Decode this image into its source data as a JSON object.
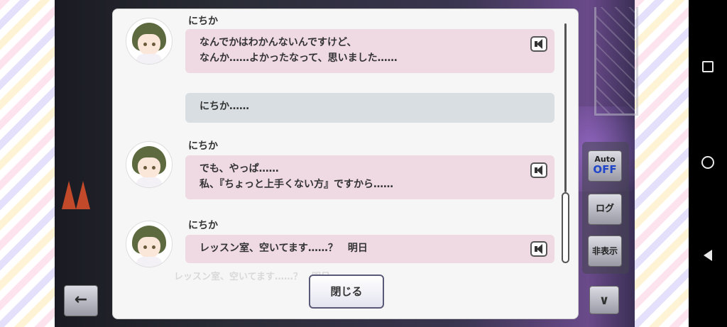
{
  "log": {
    "entries": [
      {
        "speaker": "にちか",
        "line1": "なんでかはわかんないんですけど、",
        "line2": "なんか……よかったなって、思いました……",
        "style": "pink",
        "has_voice": true
      },
      {
        "speaker": "",
        "line1": "にちか……",
        "line2": "",
        "style": "gray",
        "has_voice": false
      },
      {
        "speaker": "にちか",
        "line1": "でも、やっぱ……",
        "line2": "私、『ちょっと上手くない方』ですから……",
        "style": "pink",
        "has_voice": true
      },
      {
        "speaker": "にちか",
        "line1": "レッスン室、空いてます……？　明日",
        "line2": "",
        "style": "pink",
        "has_voice": true
      }
    ],
    "close_label": "閉じる",
    "faint_behind": "レッスン室、空いてます……？　明日"
  },
  "controls": {
    "auto_label": "Auto",
    "auto_state": "OFF",
    "log_label": "ログ",
    "hide_label": "非表示",
    "back_icon": "←",
    "down_icon": "∨"
  },
  "colors": {
    "bubble_pink": "#efd9e2",
    "bubble_gray": "#d9dee2",
    "auto_off": "#1f46c9"
  }
}
